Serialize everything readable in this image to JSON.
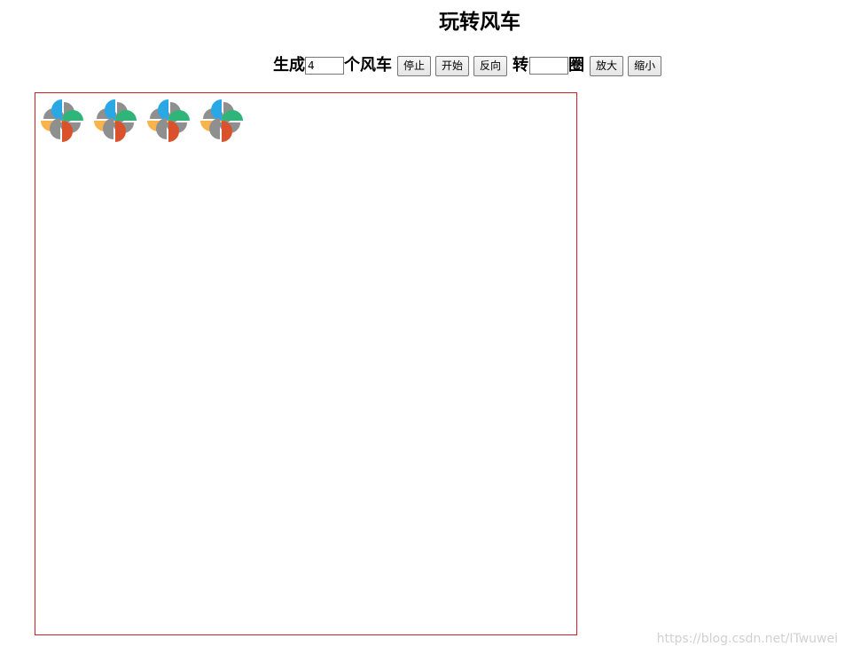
{
  "page": {
    "title": "玩转风车"
  },
  "controls": {
    "generate_label": "生成",
    "count_value": "4",
    "windmills_label": "个风车",
    "stop_label": "停止",
    "start_label": "开始",
    "reverse_label": "反向",
    "rotate_label": "转",
    "turns_value": "",
    "turns_unit_label": "圈",
    "zoom_in_label": "放大",
    "zoom_out_label": "缩小"
  },
  "stage": {
    "windmill_count": 4,
    "border_color": "#d01f25",
    "blade_colors": {
      "top_left": "#f7b44c",
      "top_right": "#2aa8e6",
      "bottom_right": "#2fb57a",
      "bottom_left": "#d9522c",
      "shadow": "#8f8f8f"
    }
  },
  "watermark": {
    "text": "https://blog.csdn.net/ITwuwei"
  }
}
